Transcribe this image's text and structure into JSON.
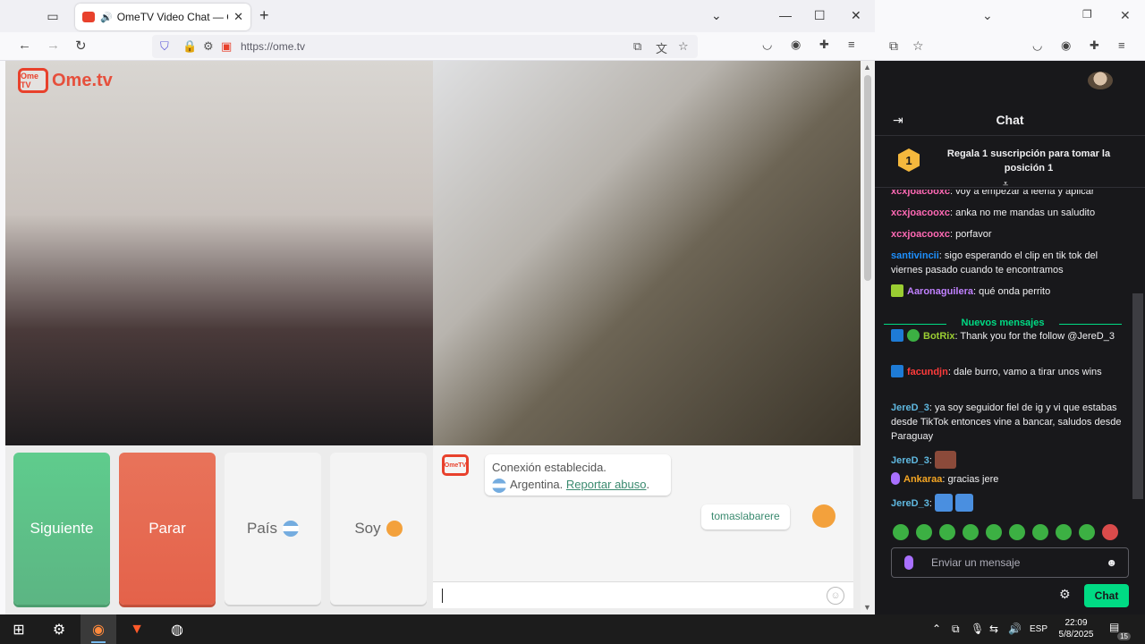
{
  "browser": {
    "tab_title": "OmeTV Video Chat — Ome",
    "url": "https://ome.tv"
  },
  "ometv": {
    "logo_badge": "Ome TV",
    "logo_text": "Ome.tv",
    "buttons": {
      "next": "Siguiente",
      "stop": "Parar",
      "country": "País",
      "me": "Soy"
    },
    "system_message": {
      "line1": "Conexión establecida.",
      "country": "Argentina.",
      "report": "Reportar abuso",
      "suffix": "."
    },
    "user_message": "tomaslabarere"
  },
  "twitch": {
    "chat_title": "Chat",
    "promo_rank": "1",
    "promo_text": "Regala 1 suscripción para tomar la posición 1",
    "new_messages_label": "Nuevos mensajes",
    "messages": [
      {
        "user": "xcxjoacooxc",
        "color": "#ff69b4",
        "text": ": voy a empezar a leerla y aplicar"
      },
      {
        "user": "xcxjoacooxc",
        "color": "#ff69b4",
        "text": ": anka no me mandas un saludito"
      },
      {
        "user": "xcxjoacooxc",
        "color": "#ff69b4",
        "text": ": porfavor"
      },
      {
        "user": "santivincii",
        "color": "#1e90ff",
        "text": ": sigo esperando el clip en tik tok del viernes pasado cuando te encontramos"
      },
      {
        "user": "Aaronaguilera",
        "color": "#c081ff",
        "text": ": qué onda perrito"
      },
      {
        "user": "BotRix",
        "color": "#9acd32",
        "text": ": Thank you for the follow @JereD_3"
      },
      {
        "user": "facundjn",
        "color": "#ff3b3b",
        "text": ": dale burro, vamo a tirar unos wins"
      },
      {
        "user": "JereD_3",
        "color": "#5fb8e0",
        "text": ": ya soy seguidor fiel de ig y vi que estabas desde TikTok entonces vine a bancar, saludos desde Paraguay"
      },
      {
        "user": "JereD_3",
        "color": "#5fb8e0",
        "text": ":"
      },
      {
        "user": "Ankaraa",
        "color": "#f5a623",
        "text": ": gracias jere"
      },
      {
        "user": "JereD_3",
        "color": "#5fb8e0",
        "text": ":"
      }
    ],
    "input_placeholder": "Enviar un mensaje",
    "send_label": "Chat",
    "accent": "#00db84"
  },
  "taskbar": {
    "lang": "ESP",
    "time": "22:09",
    "date": "5/8/2025",
    "notifications": "15"
  }
}
